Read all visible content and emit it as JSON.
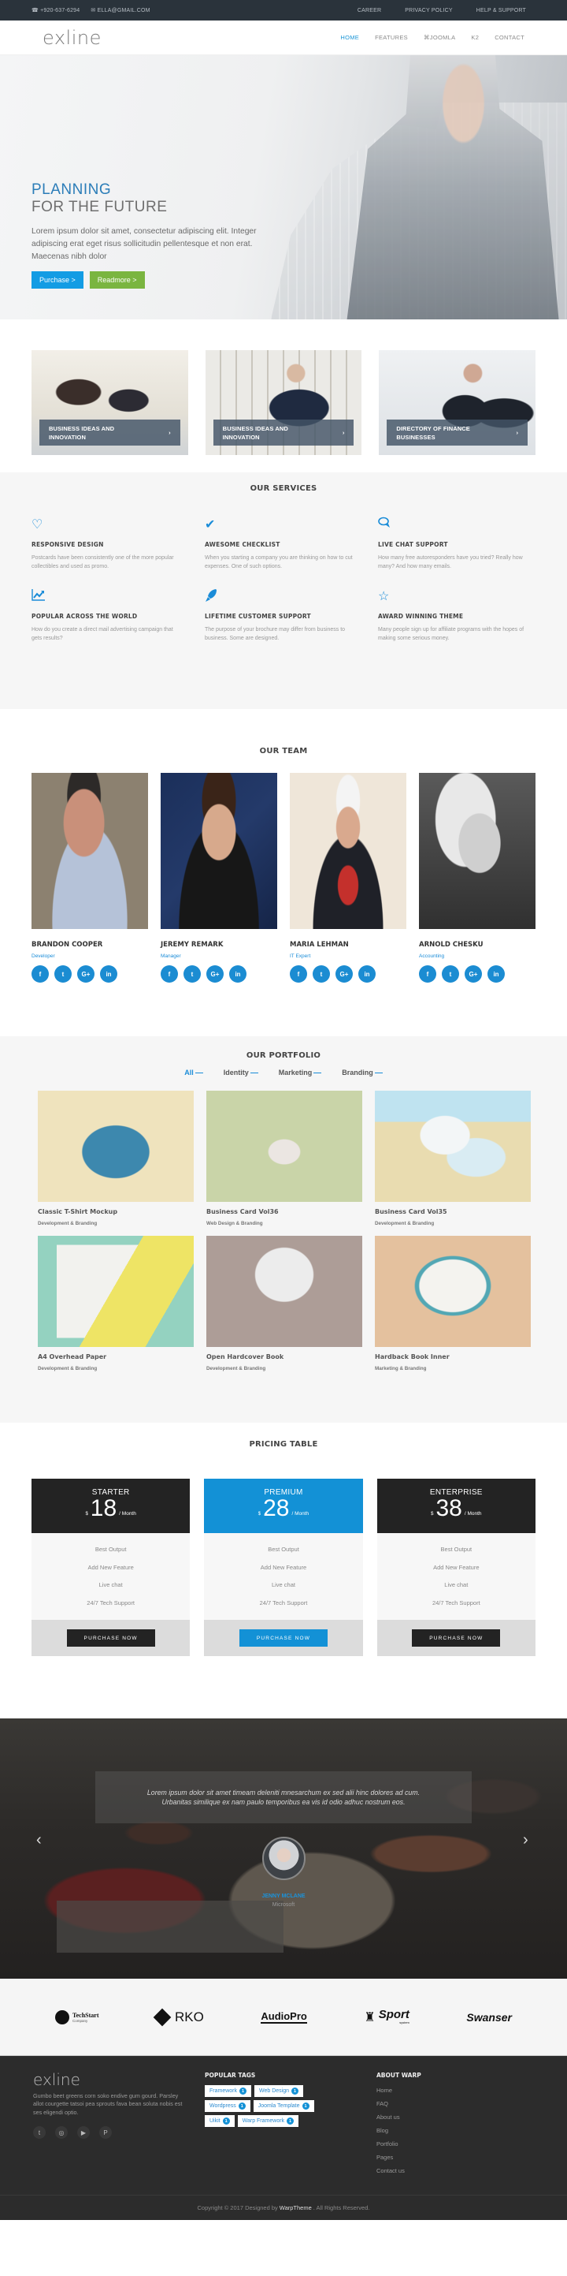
{
  "topbar": {
    "phone": "+920-637-6294",
    "email": "ELLA@GMAIL.COM",
    "links": [
      "CAREER",
      "PRIVACY POLICY",
      "HELP & SUPPORT"
    ]
  },
  "nav": {
    "logo": "exline",
    "items": [
      "HOME",
      "FEATURES",
      "JOOMLA",
      "K2",
      "CONTACT"
    ],
    "active": "HOME"
  },
  "hero": {
    "title_line1": "PLANNING",
    "title_line2": "FOR THE FUTURE",
    "text": "Lorem ipsum dolor sit amet, consectetur adipiscing elit. Integer adipiscing erat eget risus sollicitudin pellentesque et non erat. Maecenas nibh dolor",
    "purchase_label": "Purchase >",
    "readmore_label": "Readmore >"
  },
  "features": [
    {
      "title": "BUSINESS IDEAS AND INNOVATION"
    },
    {
      "title": "BUSINESS IDEAS AND INNOVATION"
    },
    {
      "title": "DIRECTORY OF FINANCE BUSINESSES"
    }
  ],
  "services": {
    "title": "OUR SERVICES",
    "items": [
      {
        "icon": "heart-icon",
        "title": "RESPONSIVE DESIGN",
        "text": "Postcards have been consistently one of the more popular collectibles and used as promo."
      },
      {
        "icon": "checkmark-icon",
        "title": "AWESOME CHECKLIST",
        "text": "When you starting a company you are thinking on how to cut expenses. One of such options."
      },
      {
        "icon": "chat-icon",
        "title": "LIVE CHAT SUPPORT",
        "text": "How many free autoresponders have you tried? Really how many? And how many emails."
      },
      {
        "icon": "chart-line-icon",
        "title": "POPULAR ACROSS THE WORLD",
        "text": "How do you create a direct mail advertising campaign that gets results?"
      },
      {
        "icon": "rocket-icon",
        "title": "LIFETIME CUSTOMER SUPPORT",
        "text": "The purpose of your brochure may differ from business to business. Some are designed."
      },
      {
        "icon": "star-icon",
        "title": "AWARD WINNING THEME",
        "text": "Many people sign up for affiliate programs with the hopes of making some serious money."
      }
    ]
  },
  "team": {
    "title": "OUR TEAM",
    "members": [
      {
        "name": "BRANDON COOPER",
        "role": "Developer"
      },
      {
        "name": "JEREMY REMARK",
        "role": "Manager"
      },
      {
        "name": "MARIA LEHMAN",
        "role": "IT Expert"
      },
      {
        "name": "ARNOLD CHESKU",
        "role": "Accounting"
      }
    ],
    "social_labels": [
      "f",
      "t",
      "G+",
      "in"
    ]
  },
  "portfolio": {
    "title": "OUR PORTFOLIO",
    "filters": [
      "All",
      "Identity",
      "Marketing",
      "Branding"
    ],
    "active_filter": "All",
    "items": [
      {
        "title": "Classic T-Shirt Mockup",
        "category": "Development & Branding"
      },
      {
        "title": "Business Card Vol36",
        "category": "Web Design & Branding"
      },
      {
        "title": "Business Card Vol35",
        "category": "Development & Branding"
      },
      {
        "title": "A4 Overhead Paper",
        "category": "Development & Branding"
      },
      {
        "title": "Open Hardcover Book",
        "category": "Development & Branding"
      },
      {
        "title": "Hardback Book Inner",
        "category": "Marketing & Branding"
      }
    ]
  },
  "pricing": {
    "title": "PRICING TABLE",
    "plans": [
      {
        "name": "STARTER",
        "currency": "$",
        "price": "18",
        "period": "/ Month",
        "highlight": false
      },
      {
        "name": "PREMIUM",
        "currency": "$",
        "price": "28",
        "period": "/ Month",
        "highlight": true
      },
      {
        "name": "ENTERPRISE",
        "currency": "$",
        "price": "38",
        "period": "/ Month",
        "highlight": false
      }
    ],
    "features": [
      "Best Output",
      "Add New Feature",
      "Live chat",
      "24/7 Tech Support"
    ],
    "button_label": "PURCHASE NOW"
  },
  "testimonial": {
    "quote": "Lorem ipsum dolor sit amet timeam deleniti mnesarchum ex sed alii hinc dolores ad cum. Urbanitas similique ex nam paulo temporibus ea vis id odio adhuc nostrum eos.",
    "name": "JENNY MCLANE",
    "company": "Microsoft",
    "prev": "‹",
    "next": "›"
  },
  "clients": [
    {
      "name": "TechStart",
      "sub": "Company"
    },
    {
      "name": "RKO"
    },
    {
      "name": "AudioPro"
    },
    {
      "name": "Sport",
      "sub": "system"
    },
    {
      "name": "Swanser"
    }
  ],
  "footer": {
    "logo": "exline",
    "description": "Gumbo beet greens corn soko endive gum gourd. Parsley allot courgette tatsoi pea sprouts fava bean soluta nobis est ses eligendi optio.",
    "tags_title": "POPULAR TAGS",
    "tags": [
      {
        "label": "Framework",
        "count": "1"
      },
      {
        "label": "Web Design",
        "count": "1"
      },
      {
        "label": "Wordpress",
        "count": "1"
      },
      {
        "label": "Joomla Template",
        "count": "1"
      },
      {
        "label": "Uikit",
        "count": "1"
      },
      {
        "label": "Warp Framework",
        "count": "1"
      }
    ],
    "about_title": "ABOUT WARP",
    "about_links": [
      "Home",
      "FAQ",
      "About us",
      "Blog",
      "Portfolio",
      "Pages",
      "Contact us"
    ],
    "copyright_pre": "Copyright © 2017 Designed by",
    "copyright_brand": "WarpTheme",
    "copyright_post": ". All Rights Reserved."
  },
  "colors": {
    "accent": "#1a8cd8",
    "green": "#7ab540",
    "dark": "#232323",
    "topbar": "#2a333b",
    "footer": "#2c2c2c"
  }
}
